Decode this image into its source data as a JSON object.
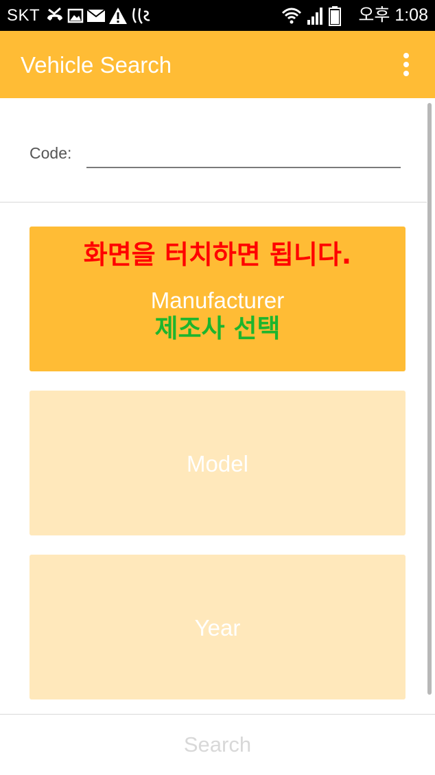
{
  "status_bar": {
    "carrier": "SKT",
    "notification_icons": [
      "missed-call-icon",
      "image-icon",
      "mail-icon",
      "warning-icon",
      "handwriting-icon"
    ],
    "system_icons": [
      "wifi-icon",
      "signal-icon",
      "battery-icon"
    ],
    "time": "오후 1:08"
  },
  "app_bar": {
    "title": "Vehicle Search",
    "overflow_icon": "more-vert-icon"
  },
  "form": {
    "code_label": "Code:",
    "code_value": "",
    "code_placeholder": ""
  },
  "cards": {
    "hint": "화면을 터치하면 됩니다.",
    "manufacturer_label": "Manufacturer",
    "manufacturer_sub": "제조사 선택",
    "model_label": "Model",
    "year_label": "Year"
  },
  "footer": {
    "search_label": "Search"
  },
  "colors": {
    "accent": "#ffbc35",
    "card_inactive": "#ffe8bb",
    "hint_red": "#ff0000",
    "sub_green": "#1db52d",
    "disabled_text": "#d8d8d8"
  }
}
